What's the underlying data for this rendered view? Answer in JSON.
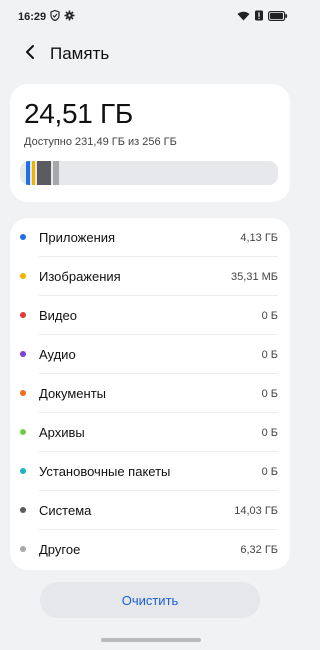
{
  "status_bar": {
    "time": "16:29",
    "left_icons": [
      "shield-icon",
      "gear-icon"
    ],
    "right_icons": [
      "wifi-icon",
      "alert-icon",
      "battery-icon"
    ]
  },
  "header": {
    "title": "Память",
    "back_icon": "chevron-left-icon"
  },
  "summary": {
    "used": "24,51 ГБ",
    "available_text": "Доступно 231,49 ГБ из 256 ГБ",
    "segments": [
      {
        "color": "#1f6fe5",
        "fraction": 0.016
      },
      {
        "color": "#f0b400",
        "fraction": 0.004
      },
      {
        "color": "#5b5c60",
        "fraction": 0.055
      },
      {
        "color": "#a7a8ab",
        "fraction": 0.025
      }
    ]
  },
  "categories": [
    {
      "label": "Приложения",
      "value": "4,13 ГБ",
      "color": "#1f6fe5"
    },
    {
      "label": "Изображения",
      "value": "35,31 МБ",
      "color": "#f0b400"
    },
    {
      "label": "Видео",
      "value": "0 Б",
      "color": "#e53935"
    },
    {
      "label": "Аудио",
      "value": "0 Б",
      "color": "#7e3fd3"
    },
    {
      "label": "Документы",
      "value": "0 Б",
      "color": "#f26b1d"
    },
    {
      "label": "Архивы",
      "value": "0 Б",
      "color": "#7ac943"
    },
    {
      "label": "Установочные пакеты",
      "value": "0 Б",
      "color": "#19b3c4"
    },
    {
      "label": "Система",
      "value": "14,03 ГБ",
      "color": "#5b5c60"
    },
    {
      "label": "Другое",
      "value": "6,32 ГБ",
      "color": "#a7a8ab"
    }
  ],
  "actions": {
    "clean_label": "Очистить"
  }
}
